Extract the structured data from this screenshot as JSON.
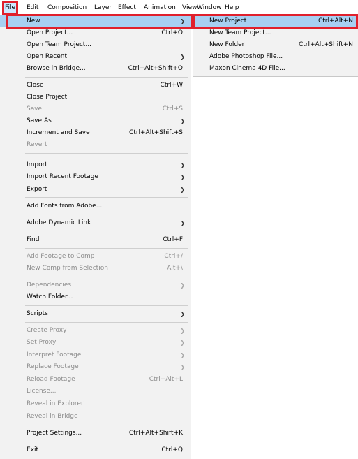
{
  "menubar": {
    "items": [
      "File",
      "Edit",
      "Composition",
      "Layer",
      "Effect",
      "Animation",
      "View",
      "Window",
      "Help"
    ]
  },
  "file_menu": {
    "items": [
      {
        "label": "New",
        "shortcut": "",
        "submenu": true,
        "disabled": false,
        "highlighted": true
      },
      {
        "label": "Open Project...",
        "shortcut": "Ctrl+O",
        "submenu": false,
        "disabled": false
      },
      {
        "label": "Open Team Project...",
        "shortcut": "",
        "submenu": false,
        "disabled": false
      },
      {
        "label": "Open Recent",
        "shortcut": "",
        "submenu": true,
        "disabled": false
      },
      {
        "label": "Browse in Bridge...",
        "shortcut": "Ctrl+Alt+Shift+O",
        "submenu": false,
        "disabled": false
      },
      {
        "label": "Close",
        "shortcut": "Ctrl+W",
        "submenu": false,
        "disabled": false
      },
      {
        "label": "Close Project",
        "shortcut": "",
        "submenu": false,
        "disabled": false
      },
      {
        "label": "Save",
        "shortcut": "Ctrl+S",
        "submenu": false,
        "disabled": true
      },
      {
        "label": "Save As",
        "shortcut": "",
        "submenu": true,
        "disabled": false
      },
      {
        "label": "Increment and Save",
        "shortcut": "Ctrl+Alt+Shift+S",
        "submenu": false,
        "disabled": false
      },
      {
        "label": "Revert",
        "shortcut": "",
        "submenu": false,
        "disabled": true
      },
      {
        "label": "Import",
        "shortcut": "",
        "submenu": true,
        "disabled": false
      },
      {
        "label": "Import Recent Footage",
        "shortcut": "",
        "submenu": true,
        "disabled": false
      },
      {
        "label": "Export",
        "shortcut": "",
        "submenu": true,
        "disabled": false
      },
      {
        "label": "Add Fonts from Adobe...",
        "shortcut": "",
        "submenu": false,
        "disabled": false
      },
      {
        "label": "Adobe Dynamic Link",
        "shortcut": "",
        "submenu": true,
        "disabled": false
      },
      {
        "label": "Find",
        "shortcut": "Ctrl+F",
        "submenu": false,
        "disabled": false
      },
      {
        "label": "Add Footage to Comp",
        "shortcut": "Ctrl+/",
        "submenu": false,
        "disabled": true
      },
      {
        "label": "New Comp from Selection",
        "shortcut": "Alt+\\",
        "submenu": false,
        "disabled": true
      },
      {
        "label": "Dependencies",
        "shortcut": "",
        "submenu": true,
        "disabled": true
      },
      {
        "label": "Watch Folder...",
        "shortcut": "",
        "submenu": false,
        "disabled": false
      },
      {
        "label": "Scripts",
        "shortcut": "",
        "submenu": true,
        "disabled": false
      },
      {
        "label": "Create Proxy",
        "shortcut": "",
        "submenu": true,
        "disabled": true
      },
      {
        "label": "Set Proxy",
        "shortcut": "",
        "submenu": true,
        "disabled": true
      },
      {
        "label": "Interpret Footage",
        "shortcut": "",
        "submenu": true,
        "disabled": true
      },
      {
        "label": "Replace Footage",
        "shortcut": "",
        "submenu": true,
        "disabled": true
      },
      {
        "label": "Reload Footage",
        "shortcut": "Ctrl+Alt+L",
        "submenu": false,
        "disabled": true
      },
      {
        "label": "License...",
        "shortcut": "",
        "submenu": false,
        "disabled": true
      },
      {
        "label": "Reveal in Explorer",
        "shortcut": "",
        "submenu": false,
        "disabled": true
      },
      {
        "label": "Reveal in Bridge",
        "shortcut": "",
        "submenu": false,
        "disabled": true
      },
      {
        "label": "Project Settings...",
        "shortcut": "Ctrl+Alt+Shift+K",
        "submenu": false,
        "disabled": false
      },
      {
        "label": "Exit",
        "shortcut": "Ctrl+Q",
        "submenu": false,
        "disabled": false
      }
    ]
  },
  "new_submenu": {
    "items": [
      {
        "label": "New Project",
        "shortcut": "Ctrl+Alt+N",
        "highlighted": true
      },
      {
        "label": "New Team Project...",
        "shortcut": ""
      },
      {
        "label": "New Folder",
        "shortcut": "Ctrl+Alt+Shift+N"
      },
      {
        "label": "Adobe Photoshop File...",
        "shortcut": ""
      },
      {
        "label": "Maxon Cinema 4D File...",
        "shortcut": ""
      }
    ]
  },
  "icons": {
    "submenu_arrow": "chevron-right-icon"
  },
  "colors": {
    "highlight": "#a7d0f2",
    "outline": "#e0202c",
    "disabled_text": "#8c8c8c",
    "menu_bg": "#f2f2f2"
  }
}
